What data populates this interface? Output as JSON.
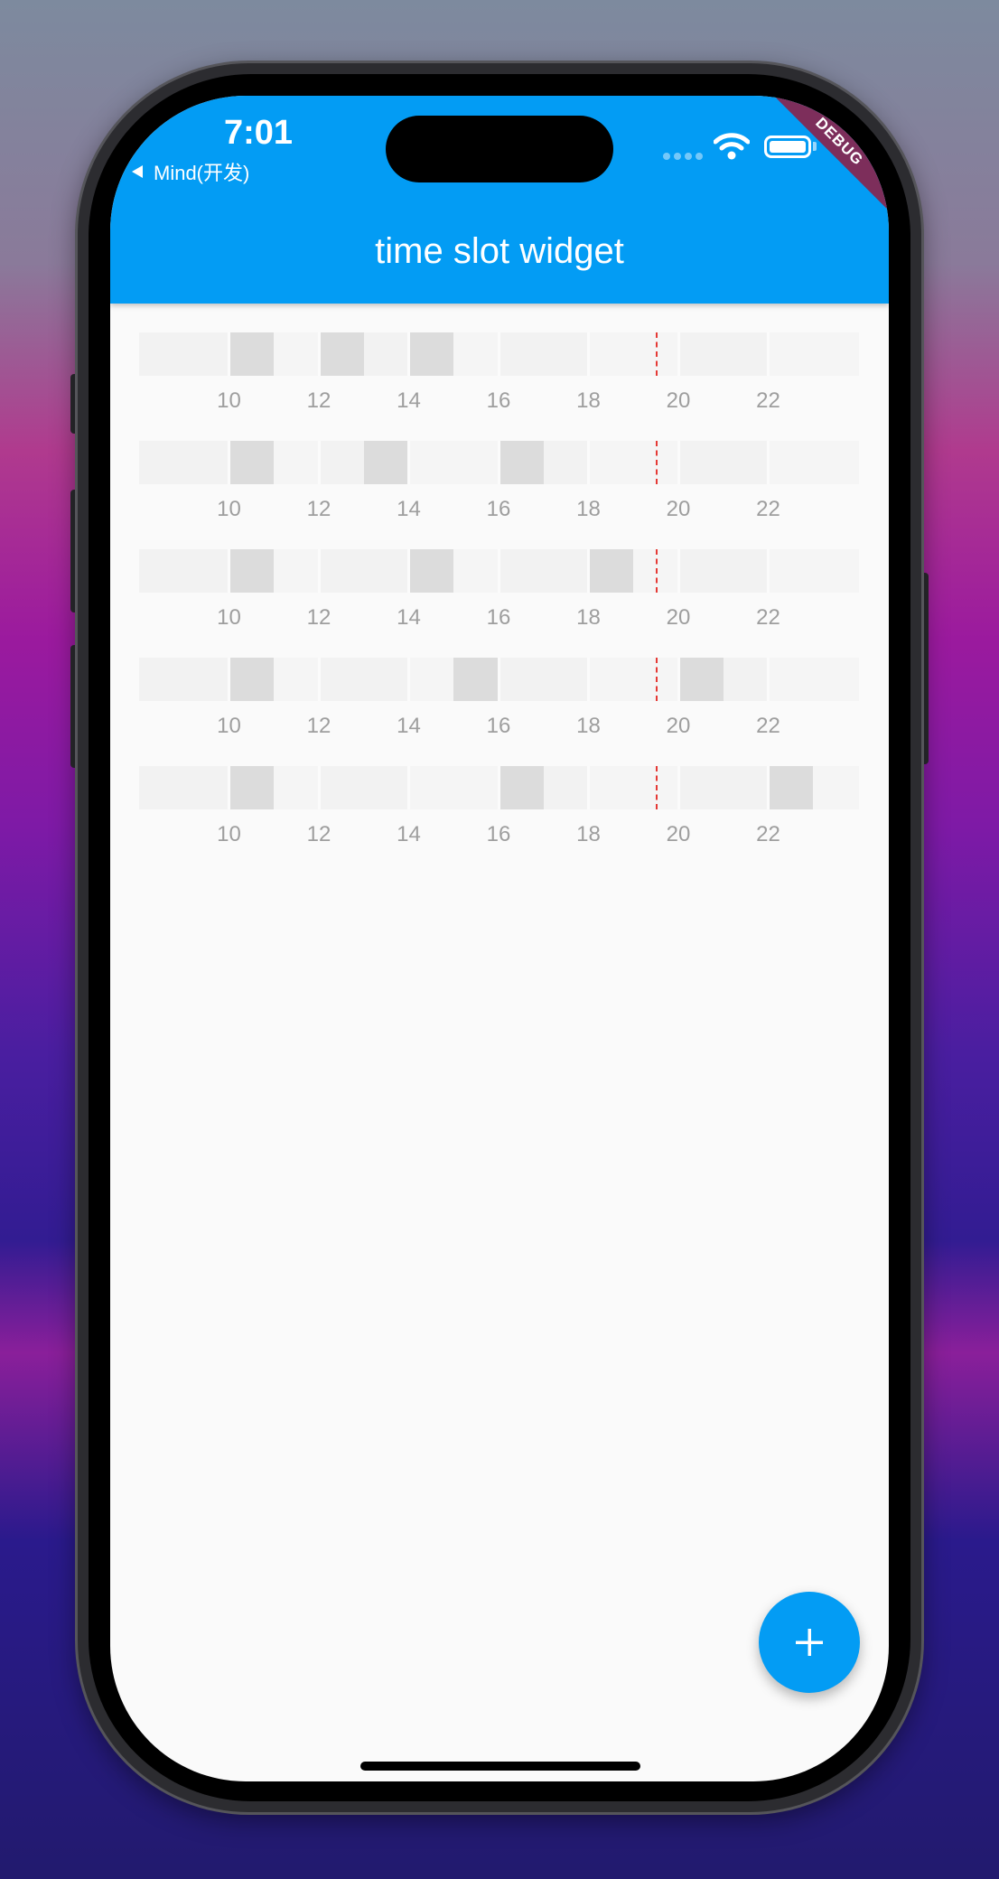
{
  "status_bar": {
    "time": "7:01",
    "back_app": "Mind(开发)",
    "icons": [
      "signal-icon",
      "wifi-icon",
      "battery-icon"
    ]
  },
  "app_bar": {
    "title": "time slot widget",
    "debug_banner": "DEBUG",
    "color": "#039cf4"
  },
  "timeline": {
    "slot_hours": [
      8,
      9,
      10,
      11,
      12,
      13,
      14,
      15,
      16,
      17,
      18,
      19,
      20,
      21,
      22,
      23
    ],
    "tick_labels": [
      "10",
      "12",
      "14",
      "16",
      "18",
      "20",
      "22"
    ],
    "current_time_hour": 19.5,
    "rows": [
      {
        "selected_hours": [
          10,
          12,
          14
        ]
      },
      {
        "selected_hours": [
          10,
          13,
          16
        ]
      },
      {
        "selected_hours": [
          10,
          14,
          18
        ]
      },
      {
        "selected_hours": [
          10,
          15,
          20
        ]
      },
      {
        "selected_hours": [
          10,
          16,
          22
        ]
      }
    ]
  },
  "fab": {
    "icon": "plus-icon",
    "color": "#039cf4"
  }
}
